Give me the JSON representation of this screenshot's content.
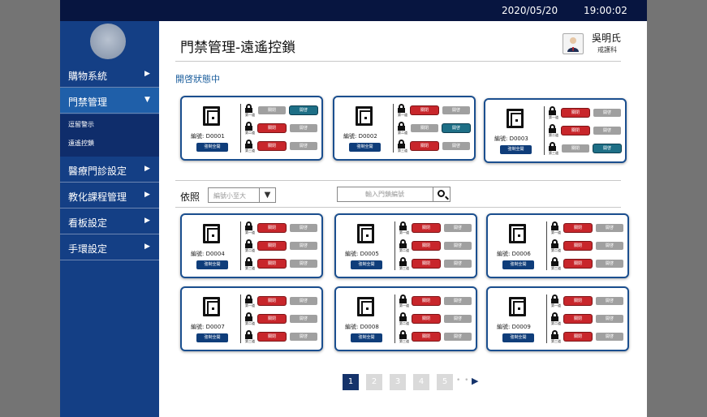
{
  "topbar": {
    "date": "2020/05/20",
    "time": "19:00:02"
  },
  "sidebar": {
    "items": [
      {
        "label": "購物系統",
        "arrow": "▶"
      },
      {
        "label": "門禁管理",
        "arrow": "▼"
      },
      {
        "label": "醫療門診設定",
        "arrow": "▶"
      },
      {
        "label": "教化課程管理",
        "arrow": "▶"
      },
      {
        "label": "看板設定",
        "arrow": "▶"
      },
      {
        "label": "手環設定",
        "arrow": "▶"
      }
    ],
    "subitems": [
      {
        "label": "逗留警示"
      },
      {
        "label": "遠遙控鎖"
      }
    ]
  },
  "header": {
    "title": "門禁管理-遠遙控鎖",
    "user_name": "吳明氏",
    "user_dept": "戒護科"
  },
  "status_heading": "開啓狀態中",
  "filter": {
    "label": "依照",
    "sort_value": "編號小至大",
    "sort_caret": "▼",
    "search_placeholder": "輸入門鎖編號"
  },
  "card_text": {
    "close": "關閉",
    "open": "開啓",
    "force_all": "強制全開",
    "lanes": [
      "第一道",
      "第二道",
      "第三道"
    ]
  },
  "open_cards": [
    {
      "code": "編號: D0001",
      "locks": [
        "open",
        "closed",
        "closed"
      ]
    },
    {
      "code": "編號: D0002",
      "locks": [
        "closed",
        "open",
        "closed"
      ]
    },
    {
      "code": "編號: D0003",
      "locks": [
        "closed",
        "closed",
        "open"
      ]
    }
  ],
  "list_cards": [
    {
      "code": "編號: D0004",
      "locks": [
        "closed",
        "closed",
        "closed"
      ]
    },
    {
      "code": "編號: D0005",
      "locks": [
        "closed",
        "closed",
        "closed"
      ]
    },
    {
      "code": "編號: D0006",
      "locks": [
        "closed",
        "closed",
        "closed"
      ]
    },
    {
      "code": "編號: D0007",
      "locks": [
        "closed",
        "closed",
        "closed"
      ]
    },
    {
      "code": "編號: D0008",
      "locks": [
        "closed",
        "closed",
        "closed"
      ]
    },
    {
      "code": "編號: D0009",
      "locks": [
        "closed",
        "closed",
        "closed"
      ]
    }
  ],
  "pagination": {
    "pages": [
      "1",
      "2",
      "3",
      "4",
      "5"
    ],
    "current": "1",
    "dots": "• •",
    "next": "▶"
  },
  "colors": {
    "sidebar": "#143f85",
    "topbar": "#071540",
    "close_active": "#c8262b",
    "open_active": "#1e6f86",
    "inactive": "#a0a0a0"
  }
}
